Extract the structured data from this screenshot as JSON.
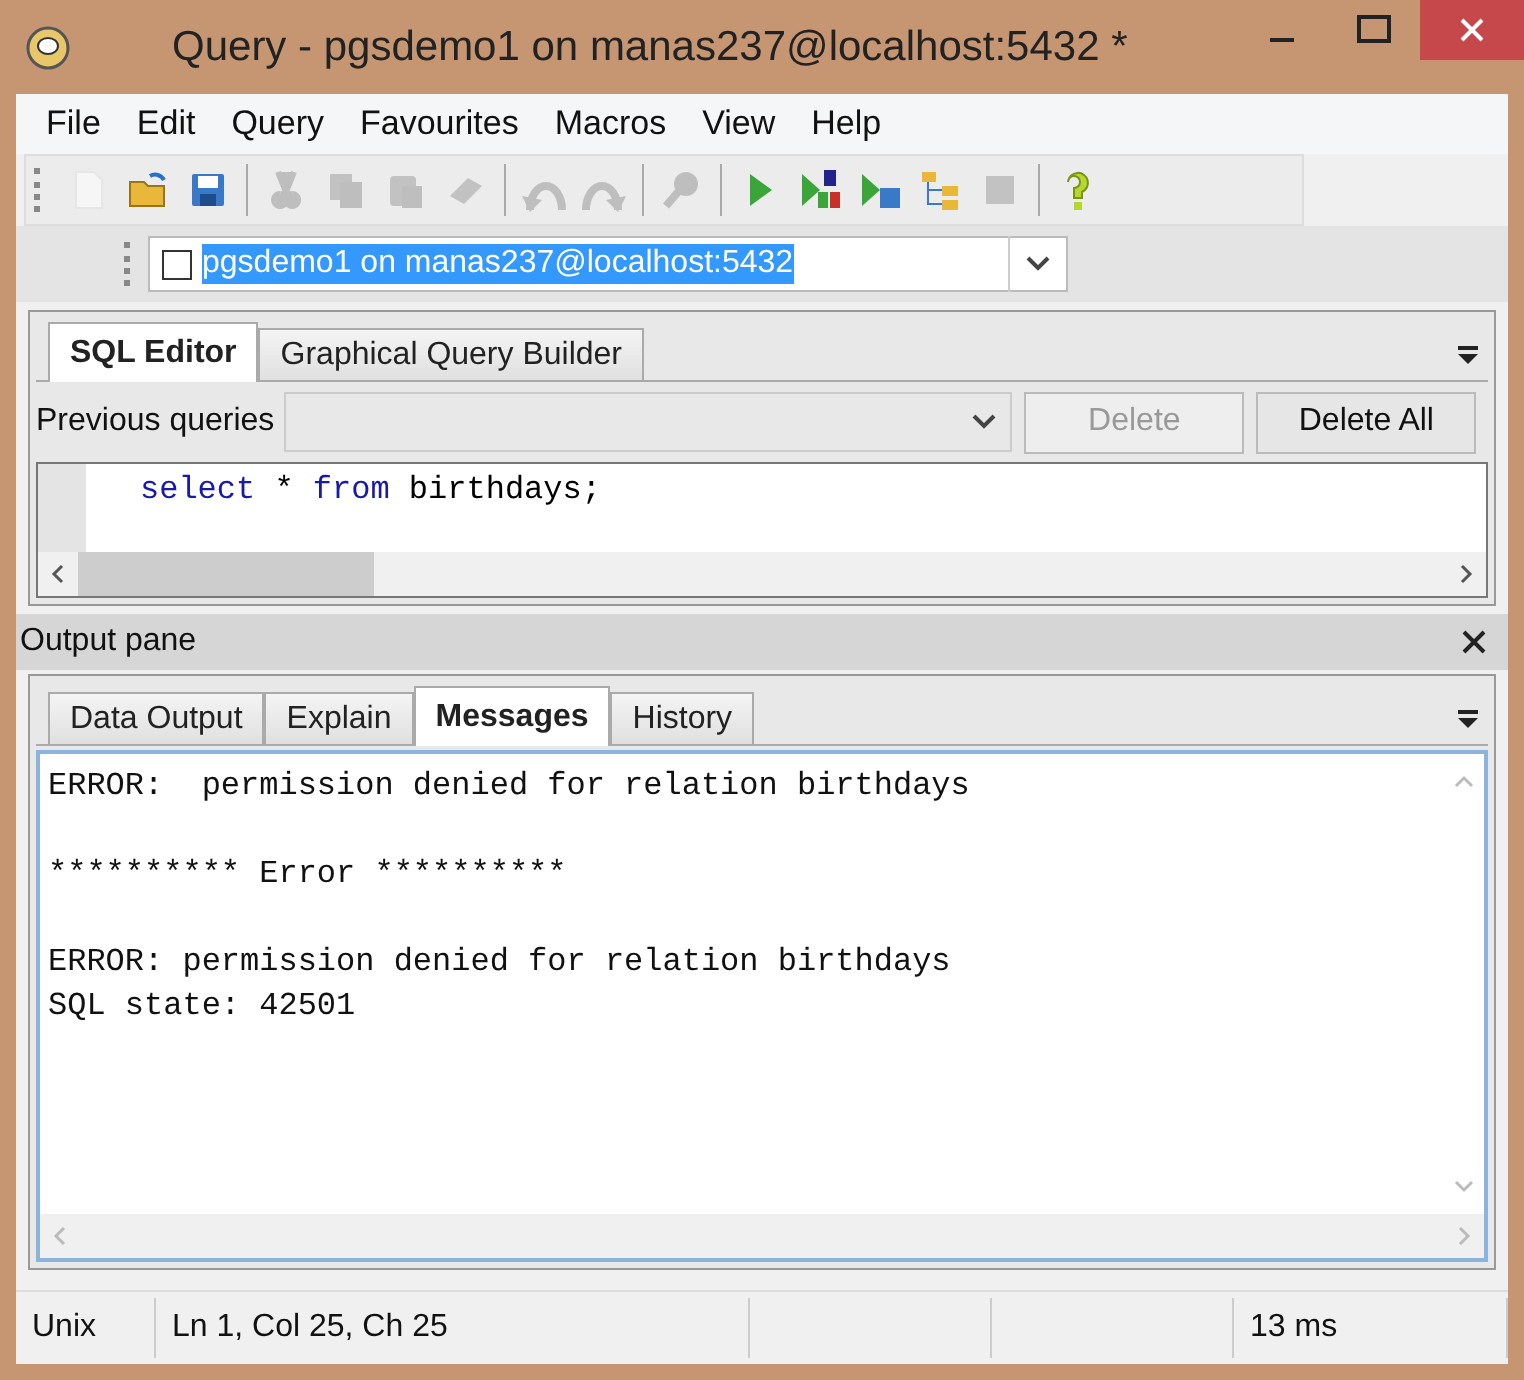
{
  "window": {
    "title": "Query - pgsdemo1 on manas237@localhost:5432 *"
  },
  "menu": [
    "File",
    "Edit",
    "Query",
    "Favourites",
    "Macros",
    "View",
    "Help"
  ],
  "toolbar": [
    {
      "kind": "new",
      "disabled": true
    },
    {
      "kind": "open",
      "disabled": false
    },
    {
      "kind": "save",
      "disabled": false
    },
    {
      "kind": "sep"
    },
    {
      "kind": "cut",
      "disabled": true
    },
    {
      "kind": "copy",
      "disabled": true
    },
    {
      "kind": "paste",
      "disabled": true
    },
    {
      "kind": "clear",
      "disabled": true
    },
    {
      "kind": "sep"
    },
    {
      "kind": "undo",
      "disabled": true
    },
    {
      "kind": "redo",
      "disabled": true
    },
    {
      "kind": "sep"
    },
    {
      "kind": "find",
      "disabled": true
    },
    {
      "kind": "sep"
    },
    {
      "kind": "run",
      "disabled": false
    },
    {
      "kind": "pgscript",
      "disabled": false
    },
    {
      "kind": "runfile",
      "disabled": false
    },
    {
      "kind": "explain",
      "disabled": false
    },
    {
      "kind": "stop",
      "disabled": true
    },
    {
      "kind": "sep"
    },
    {
      "kind": "help",
      "disabled": false
    }
  ],
  "connection": {
    "value": "pgsdemo1 on manas237@localhost:5432",
    "checked": false
  },
  "editor_tabs": [
    {
      "label": "SQL Editor",
      "selected": true
    },
    {
      "label": "Graphical Query Builder",
      "selected": false
    }
  ],
  "previous_queries": {
    "label": "Previous queries",
    "buttons": [
      {
        "label": "Delete",
        "disabled": true
      },
      {
        "label": "Delete All",
        "disabled": false
      }
    ]
  },
  "sql": [
    {
      "kind": "keyword",
      "text": "select"
    },
    {
      "kind": "plain",
      "text": " * "
    },
    {
      "kind": "keyword",
      "text": "from"
    },
    {
      "kind": "plain",
      "text": " birthdays;"
    }
  ],
  "output_pane": {
    "title": "Output pane",
    "tabs": [
      {
        "label": "Data Output",
        "selected": false
      },
      {
        "label": "Explain",
        "selected": false
      },
      {
        "label": "Messages",
        "selected": true
      },
      {
        "label": "History",
        "selected": false
      }
    ],
    "messages": [
      [
        "ERROR:  permission denied for relation birthdays"
      ],
      [
        "********** Error **********"
      ],
      [
        "ERROR: permission denied for relation birthdays",
        "SQL state: 42501"
      ]
    ]
  },
  "status_bar": [
    "Unix",
    "Ln 1, Col 25, Ch 25",
    "13 ms"
  ]
}
